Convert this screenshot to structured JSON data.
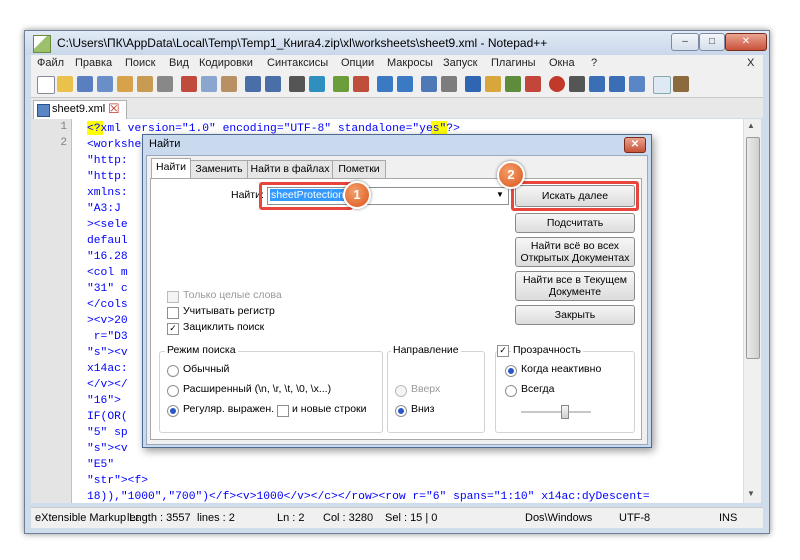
{
  "window": {
    "title": "C:\\Users\\ПК\\AppData\\Local\\Temp\\Temp1_Книга4.zip\\xl\\worksheets\\sheet9.xml - Notepad++",
    "minimize": "–",
    "maximize": "□",
    "close": "✕"
  },
  "menu": [
    "Файл",
    "Правка",
    "Поиск",
    "Вид",
    "Кодировки",
    "Синтаксисы",
    "Опции",
    "Макросы",
    "Запуск",
    "Плагины",
    "Окна",
    "?"
  ],
  "menu_close": "X",
  "tab": {
    "label": "sheet9.xml",
    "close": "☒"
  },
  "line_numbers": [
    "1",
    "2"
  ],
  "code_lines": [
    "<?xml version=\"1.0\" encoding=\"UTF-8\" standalone=\"yes\"?>",
    "<worksheet                                               xmlns:r=",
    "\"http:                                                   14ac\"",
    "\"http:                                                   mension ref",
    "xmlns:                                                   ewId=\"0\"",
    "\"A3:J                                                   atPr",
    "><sele                                                   Width=\"1\"/>",
    "defaul                                                   width=",
    "\"16.28                                                   />",
    "<col m                                                   20\" t=\"s\"",
    "\"31\" c                                                  9</v></c><c",
    "</cols                                                   s=\"20\" t=",
    "><v>20                                                   1:10\"",
    " r=\"D3                                                   0",
    "\"s\"><v                                                  r=\"E4\" s=",
    "x14ac:                                                   str\"><f>",
    "</v></                                                   row><row r=",
    "\"16\">                                                   s=\"15\" t=",
    "IF(OR(                                                   </v></c><c r",
    "\"5\" sp                                                  26\" t=",
    "\"s\"><v                                                  ",
    "\"E5\"                                                    ",
    "\"str\"><f>",
    "18)),\"1000\",\"700\")</f><v>1000</v></c></row><row r=\"6\" spans=\"1:10\" x14ac:dyDescent=",
    "\"0.25\"><c r=\"A6\" s=\"15\"><v>3</v></c><c r=\"B6\" s=\"15\" t=\"s\"><v>1</v></c><c r=\"C6\" s=\"21\"",
    "><v>1978</v></c><c r=\"D6\" s=\"16\" t=\"s\"><v>8</v></c><c r=\"E6\" s=\"16\"><v>42738</v></c><c r"
  ],
  "status": {
    "type": "eXtensible Markup Language file",
    "length": "length : 3557",
    "lines": "lines : 2",
    "ln": "Ln : 2",
    "col": "Col : 3280",
    "sel": "Sel : 15 | 0",
    "eol": "Dos\\Windows",
    "enc": "UTF-8",
    "ins": "INS"
  },
  "dialog": {
    "title": "Найти",
    "close": "✕",
    "tabs": [
      "Найти",
      "Заменить",
      "Найти в файлах",
      "Пометки"
    ],
    "find_label": "Найти:",
    "find_value": "sheetProtection",
    "buttons": {
      "find_next": "Искать далее",
      "count": "Подсчитать",
      "find_all_open": "Найти всё во всех Открытых Документах",
      "find_all_current": "Найти все в Текущем Документе",
      "close": "Закрыть"
    },
    "options": {
      "whole_word": "Только целые слова",
      "match_case": "Учитывать регистр",
      "wrap": "Зациклить поиск"
    },
    "search_mode": {
      "title": "Режим поиска",
      "normal": "Обычный",
      "extended": "Расширенный (\\n, \\r, \\t, \\0, \\x...)",
      "regex": "Регуляр. выражен.",
      "newline": "и новые строки"
    },
    "direction": {
      "title": "Направление",
      "up": "Вверх",
      "down": "Вниз"
    },
    "transparency": {
      "title": "Прозрачность",
      "on_lose_focus": "Когда неактивно",
      "always": "Всегда"
    }
  },
  "badges": {
    "one": "1",
    "two": "2"
  }
}
